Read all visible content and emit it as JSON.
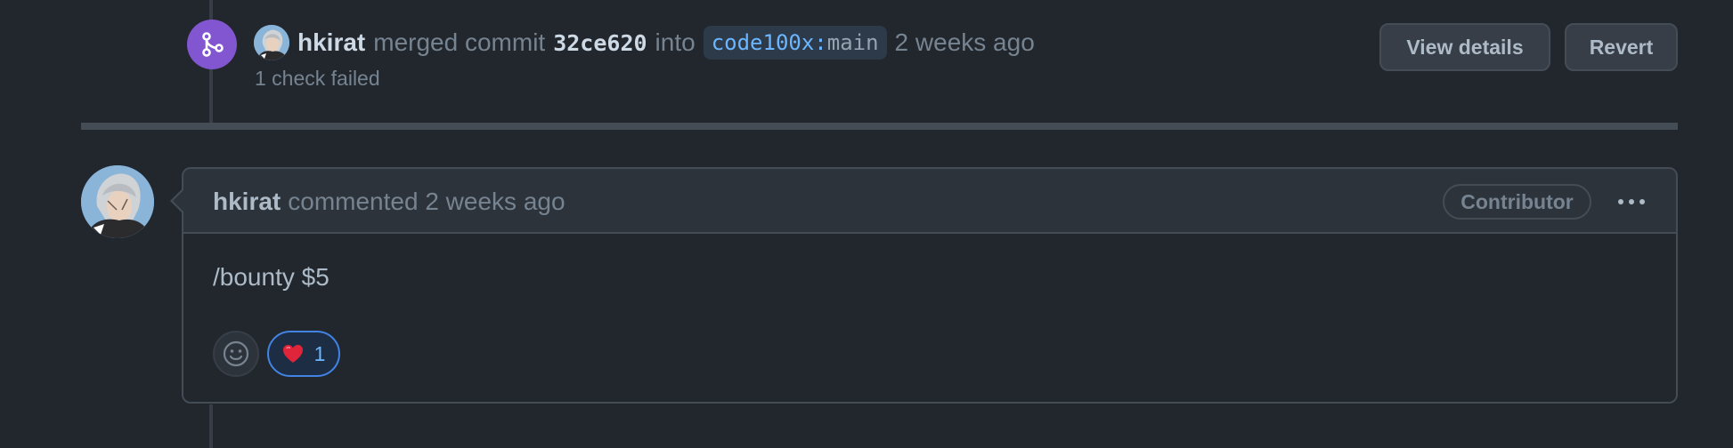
{
  "merge_event": {
    "author": "hkirat",
    "action": "merged commit",
    "commit_sha": "32ce620",
    "into_text": "into",
    "branch_repo": "code100x",
    "branch_sep": ":",
    "branch_name": "main",
    "time": "2 weeks ago",
    "check_status": "1 check failed",
    "view_details_label": "View details",
    "revert_label": "Revert",
    "badge_icon": "git-merge-icon"
  },
  "comment": {
    "author": "hkirat",
    "action": "commented",
    "time": "2 weeks ago",
    "role_badge": "Contributor",
    "body": "/bounty $5",
    "reactions": [
      {
        "emoji": "heart",
        "glyph": "❤️",
        "count": "1"
      }
    ]
  },
  "colors": {
    "background": "#22272e",
    "merge_badge": "#8256d0",
    "link_blue": "#6cb6ff",
    "border": "#444c56"
  }
}
